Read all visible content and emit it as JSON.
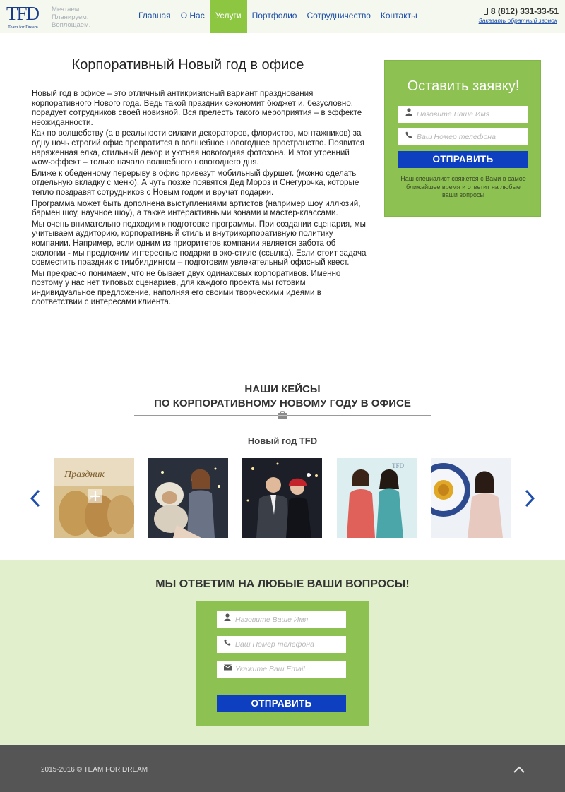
{
  "header": {
    "logo_text": "TFD",
    "logo_sub": "Team for Dream",
    "slogan": [
      "Мечтаем.",
      "Планируем.",
      "Воплощаем."
    ],
    "nav": [
      "Главная",
      "О Нас",
      "Услуги",
      "Портфолио",
      "Сотрудничество",
      "Контакты"
    ],
    "active_nav": "Услуги",
    "phone": "8 (812) 331-33-51",
    "callback": "Заказать обратный звонок"
  },
  "article": {
    "title": "Корпоративный Новый год в офисе",
    "paragraphs": [
      "Новый год в офисе – это отличный антикризисный вариант празднования корпоративного Нового года.  Ведь такой праздник сэкономит бюджет и, безусловно, порадует сотрудников своей новизной. Вся прелесть такого мероприятия – в эффекте неожиданности.",
      "Как по волшебству (а в реальности силами декораторов, флористов, монтажников) за одну ночь строгий офис превратится в волшебное новогоднее пространство. Появится наряженная елка, стильный декор и уютная новогодняя фотозона. И этот утренний wow-эффект – только начало волшебного новогоднего дня.",
      "Ближе к обеденному перерыву в офис привезут мобильный фуршет. (можно сделать отдельную вкладку с меню). А чуть позже появятся Дед Мороз и Снегурочка, которые тепло поздравят сотрудников с Новым годом и вручат подарки.",
      "Программа может быть дополнена выступлениями артистов (например шоу иллюзий, бармен шоу, научное шоу), а также интерактивными зонами и мастер-классами.",
      "Мы очень внимательно подходим к подготовке программы. При создании сценария, мы учитываем аудиторию, корпоративный стиль  и внутрикорпоративную политику компании.  Например, если одним из приоритетов компании является забота об экологии  - мы предложим интересные подарки в эко-стиле (ссылка). Если стоит задача совместить праздник с тимбилдингом – подготовим увлекательный офисный квест.",
      "Мы прекрасно понимаем, что не бывает двух одинаковых корпоративов. Именно поэтому у нас нет типовых сценариев, для каждого проекта мы готовим индивидуальное предложение, наполняя его своими творческими идеями в соответствии с интересами клиента."
    ]
  },
  "request_form": {
    "title": "Оставить заявку!",
    "name_placeholder": "Назовите Ваше Имя",
    "phone_placeholder": "Ваш Номер телефона",
    "submit": "ОТПРАВИТЬ",
    "note": "Наш специалист свяжется с Вами в самое ближайшее время и ответит на любые ваши вопросы"
  },
  "cases": {
    "title_line1": "НАШИ КЕЙСЫ",
    "title_line2": "ПО КОРПОРАТИВНОМУ НОВОМУ ГОДУ В ОФИСЕ",
    "gallery_title": "Новый год TFD",
    "first_photo_caption": "Праздник",
    "photos": [
      "gift-bags-photo",
      "monkey-mascot-photo",
      "couple-santa-hat-photo",
      "two-women-photo",
      "woman-sun-decor-photo"
    ]
  },
  "questions": {
    "title": "МЫ ОТВЕТИМ НА ЛЮБЫЕ ВАШИ ВОПРОСЫ!",
    "name_placeholder": "Назовите Ваше Имя",
    "phone_placeholder": "Ваш Номер телефона",
    "email_placeholder": "Укажите Ваш Email",
    "submit": "ОТПРАВИТЬ"
  },
  "footer": {
    "copyright": "2015-2016 © TEAM FOR DREAM"
  },
  "colors": {
    "accent_green": "#8dc152",
    "button_blue": "#0d3fc0",
    "nav_blue": "#1f4faa",
    "band_bg": "#e1efcd",
    "footer_bg": "#555555"
  }
}
